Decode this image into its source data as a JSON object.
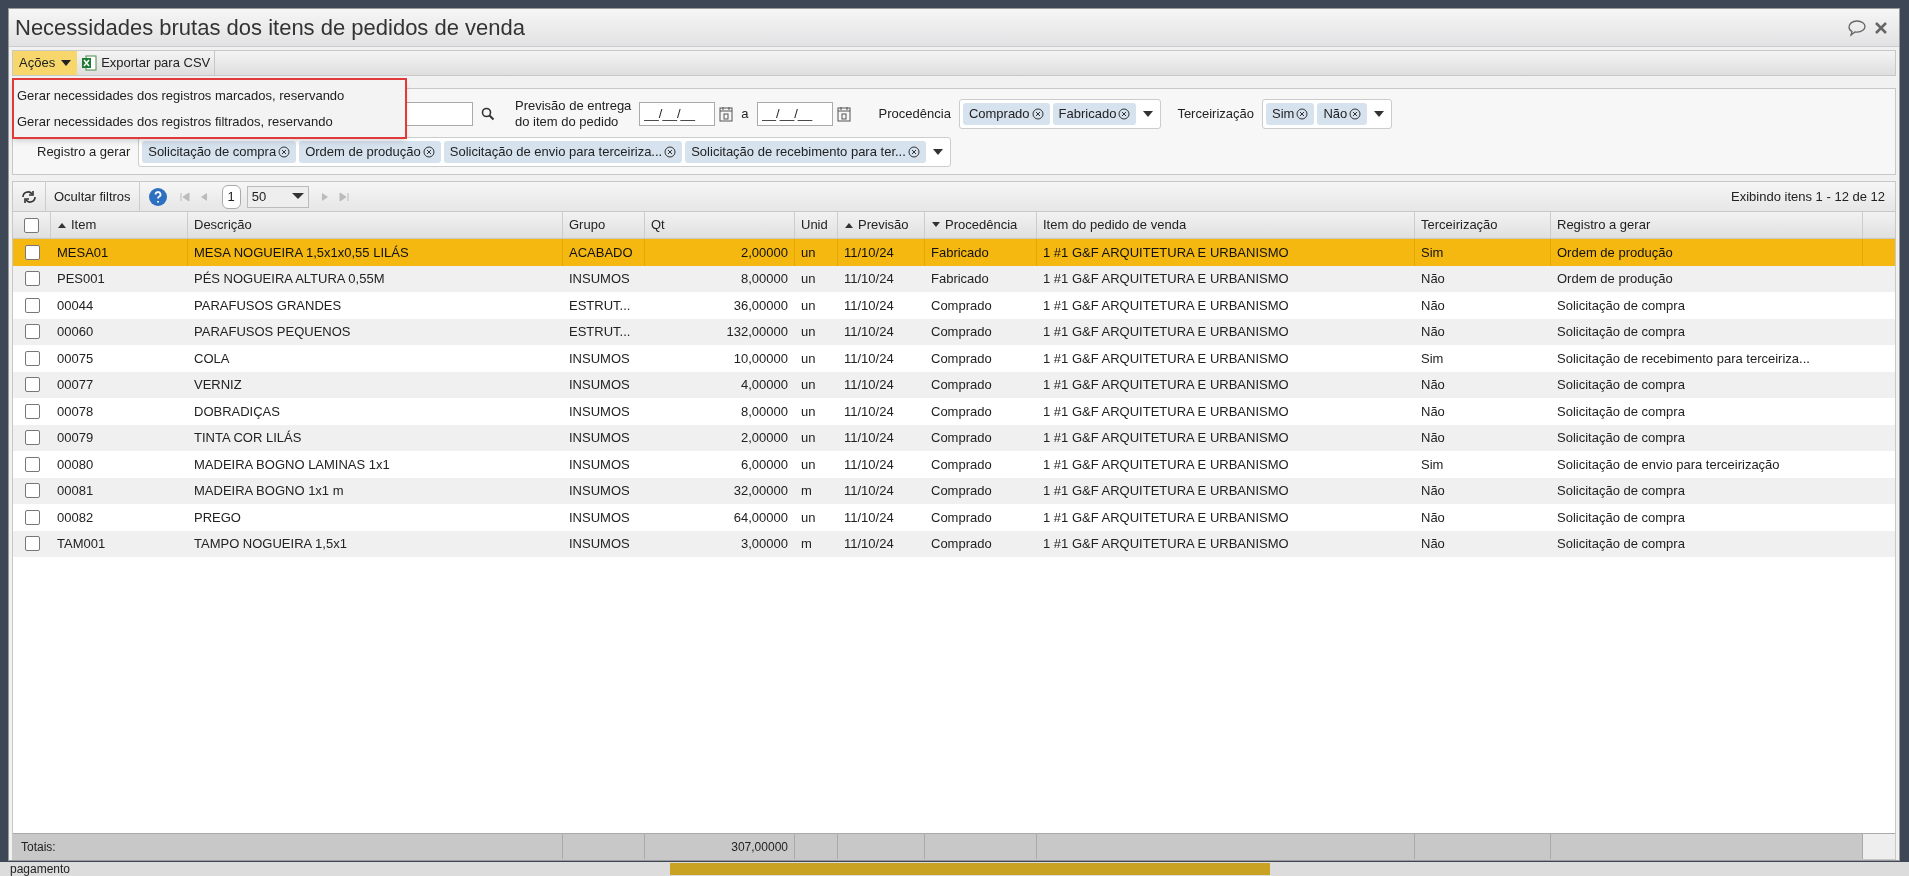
{
  "window": {
    "title": "Necessidades brutas dos itens de pedidos de venda"
  },
  "toolbar": {
    "actions_label": "Ações",
    "export_label": "Exportar para CSV"
  },
  "actions_menu": {
    "open": true,
    "items": [
      "Gerar necessidades dos registros marcados, reservando",
      "Gerar necessidades dos registros filtrados, reservando"
    ]
  },
  "filters": {
    "delivery_label_line1": "Previsão de entrega",
    "delivery_label_line2": "do item do pedido",
    "date_from_placeholder": "__/__/__",
    "date_separator": "a",
    "date_to_placeholder": "__/__/__",
    "procedencia_label": "Procedência",
    "procedencia_tags": [
      "Comprado",
      "Fabricado"
    ],
    "terceirizacao_label": "Terceirização",
    "terceirizacao_tags": [
      "Sim",
      "Não"
    ],
    "registro_label": "Registro a gerar",
    "registro_tags": [
      "Solicitação de compra",
      "Ordem de produção",
      "Solicitação de envio para terceiriza...",
      "Solicitação de recebimento para ter..."
    ]
  },
  "grid_toolbar": {
    "hide_filters": "Ocultar filtros",
    "page": "1",
    "page_size": "50",
    "summary": "Exibindo itens 1 - 12 de 12"
  },
  "table": {
    "columns": [
      {
        "label": "Item",
        "sorted": true,
        "descending": false
      },
      {
        "label": "Descrição",
        "sorted": false
      },
      {
        "label": "Grupo",
        "sorted": false
      },
      {
        "label": "Qt",
        "sorted": false
      },
      {
        "label": "Unid",
        "sorted": false
      },
      {
        "label": "Previsão",
        "sorted": true,
        "descending": false
      },
      {
        "label": "Procedência",
        "sorted": true,
        "descending": true
      },
      {
        "label": "Item do pedido de venda",
        "sorted": false
      },
      {
        "label": "Terceirização",
        "sorted": false
      },
      {
        "label": "Registro a gerar",
        "sorted": false
      }
    ],
    "rows": [
      {
        "selected": true,
        "checked": false,
        "cells": [
          "MESA01",
          "MESA NOGUEIRA 1,5x1x0,55 LILÁS",
          "ACABADO",
          "2,00000",
          "un",
          "11/10/24",
          "Fabricado",
          "1 #1 G&F ARQUITETURA E URBANISMO",
          "Sim",
          "Ordem de produção"
        ]
      },
      {
        "selected": false,
        "checked": false,
        "cells": [
          "PES001",
          "PÉS NOGUEIRA ALTURA 0,55M",
          "INSUMOS",
          "8,00000",
          "un",
          "11/10/24",
          "Fabricado",
          "1 #1 G&F ARQUITETURA E URBANISMO",
          "Não",
          "Ordem de produção"
        ]
      },
      {
        "selected": false,
        "checked": false,
        "cells": [
          "00044",
          "PARAFUSOS GRANDES",
          "ESTRUT...",
          "36,00000",
          "un",
          "11/10/24",
          "Comprado",
          "1 #1 G&F ARQUITETURA E URBANISMO",
          "Não",
          "Solicitação de compra"
        ]
      },
      {
        "selected": false,
        "checked": false,
        "cells": [
          "00060",
          "PARAFUSOS PEQUENOS",
          "ESTRUT...",
          "132,00000",
          "un",
          "11/10/24",
          "Comprado",
          "1 #1 G&F ARQUITETURA E URBANISMO",
          "Não",
          "Solicitação de compra"
        ]
      },
      {
        "selected": false,
        "checked": false,
        "cells": [
          "00075",
          "COLA",
          "INSUMOS",
          "10,00000",
          "un",
          "11/10/24",
          "Comprado",
          "1 #1 G&F ARQUITETURA E URBANISMO",
          "Sim",
          "Solicitação de recebimento para terceiriza..."
        ]
      },
      {
        "selected": false,
        "checked": false,
        "cells": [
          "00077",
          "VERNIZ",
          "INSUMOS",
          "4,00000",
          "un",
          "11/10/24",
          "Comprado",
          "1 #1 G&F ARQUITETURA E URBANISMO",
          "Não",
          "Solicitação de compra"
        ]
      },
      {
        "selected": false,
        "checked": false,
        "cells": [
          "00078",
          "DOBRADIÇAS",
          "INSUMOS",
          "8,00000",
          "un",
          "11/10/24",
          "Comprado",
          "1 #1 G&F ARQUITETURA E URBANISMO",
          "Não",
          "Solicitação de compra"
        ]
      },
      {
        "selected": false,
        "checked": false,
        "cells": [
          "00079",
          "TINTA COR LILÁS",
          "INSUMOS",
          "2,00000",
          "un",
          "11/10/24",
          "Comprado",
          "1 #1 G&F ARQUITETURA E URBANISMO",
          "Não",
          "Solicitação de compra"
        ]
      },
      {
        "selected": false,
        "checked": false,
        "cells": [
          "00080",
          "MADEIRA BOGNO LAMINAS 1x1",
          "INSUMOS",
          "6,00000",
          "un",
          "11/10/24",
          "Comprado",
          "1 #1 G&F ARQUITETURA E URBANISMO",
          "Sim",
          "Solicitação de envio para terceirização"
        ]
      },
      {
        "selected": false,
        "checked": false,
        "cells": [
          "00081",
          "MADEIRA BOGNO 1x1 m",
          "INSUMOS",
          "32,00000",
          "m",
          "11/10/24",
          "Comprado",
          "1 #1 G&F ARQUITETURA E URBANISMO",
          "Não",
          "Solicitação de compra"
        ]
      },
      {
        "selected": false,
        "checked": false,
        "cells": [
          "00082",
          "PREGO",
          "INSUMOS",
          "64,00000",
          "un",
          "11/10/24",
          "Comprado",
          "1 #1 G&F ARQUITETURA E URBANISMO",
          "Não",
          "Solicitação de compra"
        ]
      },
      {
        "selected": false,
        "checked": false,
        "cells": [
          "TAM001",
          "TAMPO NOGUEIRA 1,5x1",
          "INSUMOS",
          "3,00000",
          "m",
          "11/10/24",
          "Comprado",
          "1 #1 G&F ARQUITETURA E URBANISMO",
          "Não",
          "Solicitação de compra"
        ]
      }
    ],
    "all_checked": false,
    "totals_label": "Totais:",
    "total_qt": "307,00000"
  },
  "background": {
    "text": "pagamento"
  }
}
